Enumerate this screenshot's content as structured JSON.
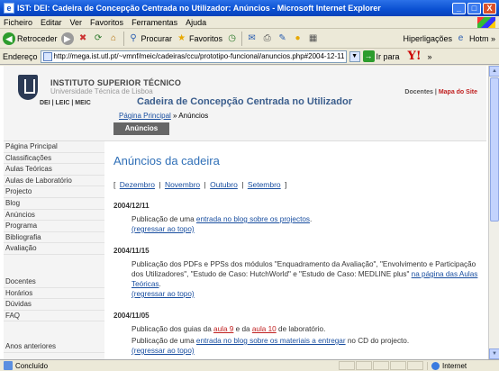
{
  "window": {
    "title": "IST: DEI: Cadeira de Concepção Centrada no Utilizador: Anúncios - Microsoft Internet Explorer",
    "min": "_",
    "max": "□",
    "close": "X"
  },
  "menu": [
    "Ficheiro",
    "Editar",
    "Ver",
    "Favoritos",
    "Ferramentas",
    "Ajuda"
  ],
  "toolbar": {
    "back": "Retroceder",
    "search": "Procurar",
    "favorites": "Favoritos",
    "links": "Hiperligações",
    "hotmail": "Hotm »"
  },
  "address": {
    "label": "Endereço",
    "url": "http://mega.ist.utl.pt/~vmnf/meic/cadeiras/ccu/prototipo-funcional/anuncios.php#2004-12-11",
    "go": "Ir para",
    "yahoo": "Y!",
    "extra": "»"
  },
  "header": {
    "institution": "INSTITUTO SUPERIOR TÉCNICO",
    "institution_sub": "Universidade Técnica de Lisboa",
    "depts": "DEI | LEIC | MEIC",
    "course_title": "Cadeira de Concepção Centrada no Utilizador",
    "link_docentes": "Docentes",
    "link_sep": "|",
    "link_mapa": "Mapa do Site",
    "breadcrumb_home": "Página Principal",
    "breadcrumb_sep": "»",
    "breadcrumb_current": "Anúncios",
    "tab": "Anúncios"
  },
  "nav": {
    "group1": [
      "Página Principal",
      "Classificações",
      "Aulas Teóricas",
      "Aulas de Laboratório",
      "Projecto",
      "Blog",
      "Anúncios",
      "Programa",
      "Bibliografia",
      "Avaliação"
    ],
    "group2": [
      "Docentes",
      "Horários",
      "Dúvidas",
      "FAQ"
    ],
    "group3": [
      "Anos anteriores"
    ]
  },
  "main": {
    "heading": "Anúncios da cadeira",
    "months_open": "[",
    "months": [
      "Dezembro",
      "Novembro",
      "Outubro",
      "Setembro"
    ],
    "months_sep": "|",
    "months_close": "]",
    "back_to_top": "(regressar ao topo)",
    "entries": [
      {
        "date": "2004/12/11",
        "pre": "Publicação de uma ",
        "link": "entrada no blog sobre os projectos",
        "post": "."
      },
      {
        "date": "2004/11/15",
        "pre": "Publicação dos PDFs e PPSs dos módulos \"Enquadramento da Avaliação\", \"Envolvimento e Participação dos Utilizadores\", \"Estudo de Caso: HutchWorld\" e \"Estudo de Caso: MEDLINE plus\" ",
        "link": "na página das Aulas Teóricas",
        "post": "."
      },
      {
        "date": "2004/11/05",
        "line1_pre": "Publicação dos guias da ",
        "line1_link1": "aula 9",
        "line1_mid": " e da ",
        "line1_link2": "aula 10",
        "line1_post": " de laboratório.",
        "line2_pre": "Publicação de uma ",
        "line2_link": "entrada no blog sobre os materiais a entregar",
        "line2_post": " no CD do projecto."
      }
    ]
  },
  "status": {
    "text": "Concluído",
    "zone": "Internet"
  }
}
